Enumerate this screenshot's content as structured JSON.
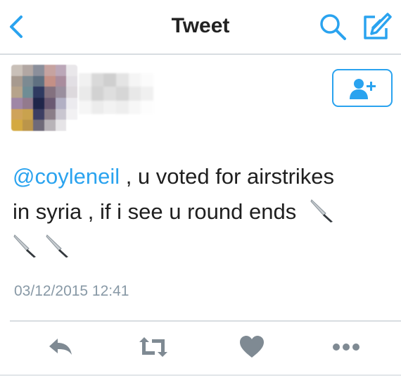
{
  "header": {
    "title": "Tweet",
    "back_icon": "chevron-left-icon",
    "search_icon": "search-icon",
    "compose_icon": "compose-icon",
    "accent_color": "#2aa3ef"
  },
  "author": {
    "avatar": "pixelated-avatar",
    "name_obscured": true,
    "follow_icon": "add-user-icon"
  },
  "tweet": {
    "mention": "@coyleneil",
    "text_line1": " , u voted for airstrikes",
    "text_line2": "in syria , if i see u round ends",
    "emoji": "knife-emoji",
    "timestamp": "03/12/2015 12:41"
  },
  "actions": {
    "icons": [
      "reply-icon",
      "retweet-icon",
      "like-icon",
      "more-icon"
    ],
    "icon_color": "#7f8a93"
  }
}
